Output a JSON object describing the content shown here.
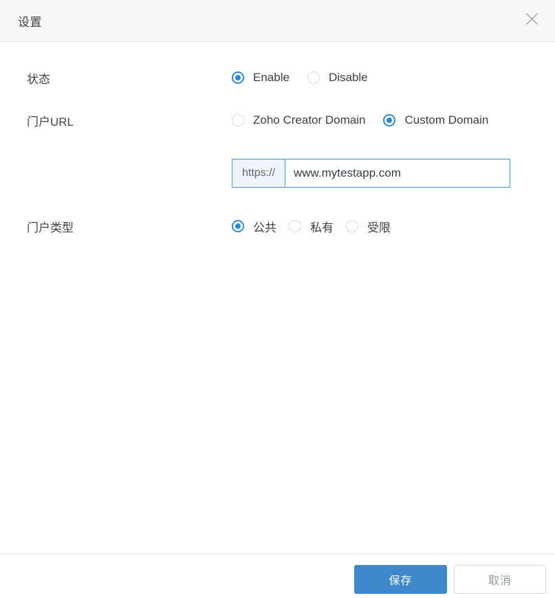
{
  "dialog": {
    "title": "设置"
  },
  "icons": {
    "close": "✕"
  },
  "fields": {
    "status": {
      "label": "状态",
      "options": [
        {
          "label": "Enable",
          "selected": true
        },
        {
          "label": "Disable",
          "selected": false
        }
      ]
    },
    "portal_url": {
      "label": "门户URL",
      "options": [
        {
          "label": "Zoho Creator Domain",
          "selected": false
        },
        {
          "label": "Custom Domain",
          "selected": true
        }
      ],
      "url_prefix": "https://",
      "url_value": "www.mytestapp.com"
    },
    "portal_type": {
      "label": "门户类型",
      "options": [
        {
          "label": "公共",
          "selected": true
        },
        {
          "label": "私有",
          "selected": false
        },
        {
          "label": "受限",
          "selected": false
        }
      ]
    }
  },
  "footer": {
    "save_label": "保存",
    "cancel_label": "取消"
  },
  "colors": {
    "accent_blue": "#2b87d8",
    "save_button_blue": "#3e87c8",
    "input_border_blue": "#4a90ca",
    "header_background": "#f7f7f7"
  }
}
